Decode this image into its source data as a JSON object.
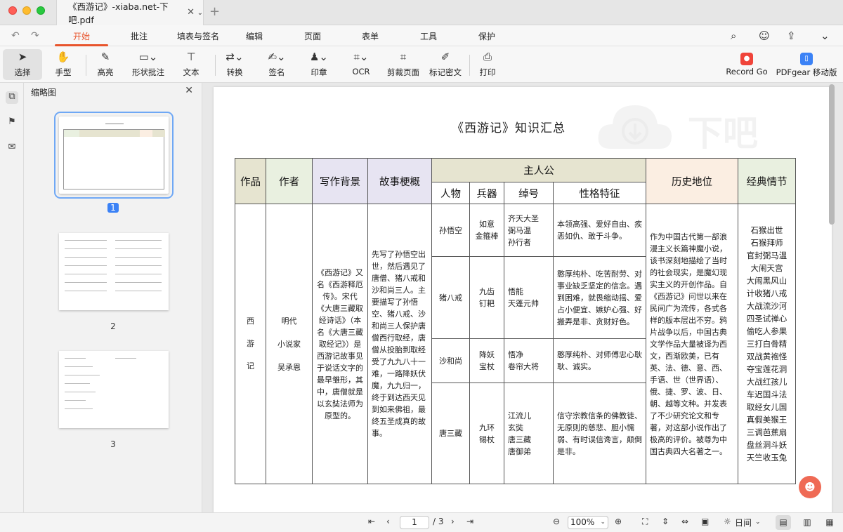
{
  "window": {
    "tab_title": "《西游记》-xiaba.net-下吧.pdf",
    "new_tab": "+"
  },
  "menu": {
    "tabs": [
      "开始",
      "批注",
      "填表与签名",
      "编辑",
      "页面",
      "表单",
      "工具",
      "保护"
    ],
    "active": "开始"
  },
  "toolbar": {
    "select": "选择",
    "hand": "手型",
    "highlight": "高亮",
    "shape": "形状批注",
    "text": "文本",
    "convert": "转换",
    "sign": "签名",
    "stamp": "印章",
    "ocr": "OCR",
    "crop": "剪裁页面",
    "redact": "标记密文",
    "print": "打印",
    "record": "Record Go",
    "mobile": "PDFgear 移动版"
  },
  "sidebar": {
    "title": "缩略图",
    "pages": [
      "1",
      "2",
      "3"
    ]
  },
  "document": {
    "title": "《西游记》知识汇总",
    "watermark": "下吧",
    "headers": {
      "work": "作品",
      "author": "作者",
      "background": "写作背景",
      "plot": "故事梗概",
      "protagonist": "主人公",
      "person": "人物",
      "weapon": "兵器",
      "nickname": "绰号",
      "character": "性格特征",
      "status": "历史地位",
      "classic": "经典情节"
    },
    "work": [
      "西",
      "游",
      "记"
    ],
    "author": [
      "明代",
      "小说家",
      "吴承恩"
    ],
    "background": "《西游记》又名《西游释厄传》。宋代《大唐三藏取经诗话》（本名《大唐三藏取经记》）是西游记故事见于说话文字的最早雏形，其中，唐僧就是以玄奘法师为原型的。",
    "plot": "先写了孙悟空出世，然后遇见了唐僧、猪八戒和沙和尚三人。主要描写了孙悟空、猪八戒、沙和尚三人保护唐僧西行取经，唐僧从投胎到取经受了九九八十一难，一路降妖伏魔，九九归一，终于到达西天见到如来佛祖，最终五圣成真的故事。",
    "characters": [
      {
        "name": "孙悟空",
        "weapon": "如意\n金箍棒",
        "nickname": "齐天大圣\n弼马温\n孙行者",
        "trait": "本领高强、爱好自由、疾恶如仇、敢于斗争。"
      },
      {
        "name": "猪八戒",
        "weapon": "九齿\n钉耙",
        "nickname": "悟能\n天蓬元帅",
        "trait": "憨厚纯朴、吃苦耐劳、对事业缺乏坚定的信念。遇到困难，就畏缩动摇、爱占小便宜、嫉妒心强、好搬弄是非、贪财好色。"
      },
      {
        "name": "沙和尚",
        "weapon": "降妖\n宝杖",
        "nickname": "悟净\n卷帘大将",
        "trait": "憨厚纯朴、对师傅忠心耿耿、诚实。"
      },
      {
        "name": "唐三藏",
        "weapon": "九环\n锡杖",
        "nickname": "江流儿\n玄奘\n唐三藏\n唐御弟",
        "trait": "信守宗教信条的佛教徒、无原则的慈悲、胆小懦弱、有时误信谗言，颠倒是非。"
      }
    ],
    "status": "作为中国古代第一部浪漫主义长篇神魔小说，该书深刻地描绘了当时的社会现实，是魔幻现实主义的开创作品。自《西游记》问世以来在民间广为流传，各式各样的版本层出不穷。鸦片战争以后，中国古典文学作品大量被译为西文，西渐欧美，已有英、法、德、意、西、手语、世（世界语）、俄、捷、罗、波、日、朝、越等文种。并发表了不少研究论文和专著，对这部小说作出了极高的评价。被尊为中国古典四大名著之一。",
    "classic": "石猴出世\n石猴拜师\n官封弼马温\n大闹天宫\n大闹黑风山\n计收猪八戒\n大战流沙河\n四圣试禅心\n偷吃人参果\n三打白骨精\n双战黄袍怪\n夺宝莲花洞\n大战红孩儿\n车迟国斗法\n取经女儿国\n真假美猴王\n三调芭蕉扇\n盘丝洞斗妖\n天竺收玉兔"
  },
  "bottom": {
    "current_page": "1",
    "total": "/ 3",
    "zoom": "100%",
    "theme": "日间"
  }
}
